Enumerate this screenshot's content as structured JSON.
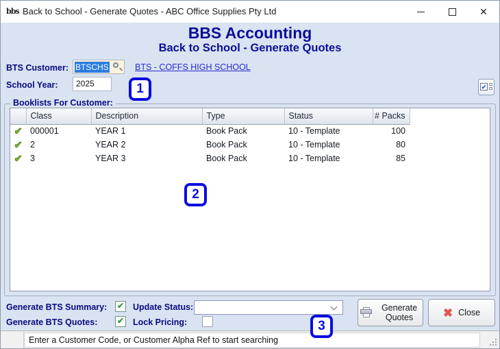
{
  "window": {
    "title": "Back to School - Generate Quotes - ABC Office Supplies Pty Ltd",
    "app_icon_text": "bbs"
  },
  "header": {
    "title": "BBS Accounting",
    "subtitle": "Back to School - Generate Quotes"
  },
  "form": {
    "customer_label": "BTS Customer:",
    "customer_value": "BTSCHS",
    "customer_link": "BTS - COFFS HIGH SCHOOL",
    "school_year_label": "School Year:",
    "school_year_value": "2025"
  },
  "booklists": {
    "group_label": "Booklists For Customer:",
    "columns": [
      "Class",
      "Description",
      "Type",
      "Status",
      "# Packs"
    ],
    "rows": [
      {
        "class": "000001",
        "description": "YEAR 1",
        "type": "Book Pack",
        "status": "10 - Template",
        "packs": "100"
      },
      {
        "class": "2",
        "description": "YEAR 2",
        "type": "Book Pack",
        "status": "10 - Template",
        "packs": "80"
      },
      {
        "class": "3",
        "description": "YEAR 3",
        "type": "Book Pack",
        "status": "10 - Template",
        "packs": "85"
      }
    ]
  },
  "options": {
    "generate_summary_label": "Generate BTS Summary:",
    "generate_summary_checked": true,
    "update_status_label": "Update Status:",
    "update_status_value": "",
    "generate_quotes_label": "Generate BTS Quotes:",
    "generate_quotes_checked": true,
    "lock_pricing_label": "Lock Pricing:",
    "lock_pricing_checked": false
  },
  "actions": {
    "generate_quotes": "Generate Quotes",
    "close": "Close"
  },
  "status_bar": {
    "message": "Enter a Customer Code, or Customer Alpha Ref to start searching"
  },
  "annotations": [
    {
      "label": "1"
    },
    {
      "label": "2"
    },
    {
      "label": "3"
    }
  ],
  "colors": {
    "body_background": "#d9e3f1",
    "heading_navy": "#0d0d99",
    "label_navy": "#0a0a80",
    "link_blue": "#2a2ad0",
    "annotation_blue": "#0b0be0",
    "selection_blue": "#2a7ce0",
    "row_check_green": "#86c440",
    "checkbox_check_green": "#2f9e3b",
    "close_x_red": "#e0574b",
    "customer_field_cream": "#fdf3dc"
  }
}
